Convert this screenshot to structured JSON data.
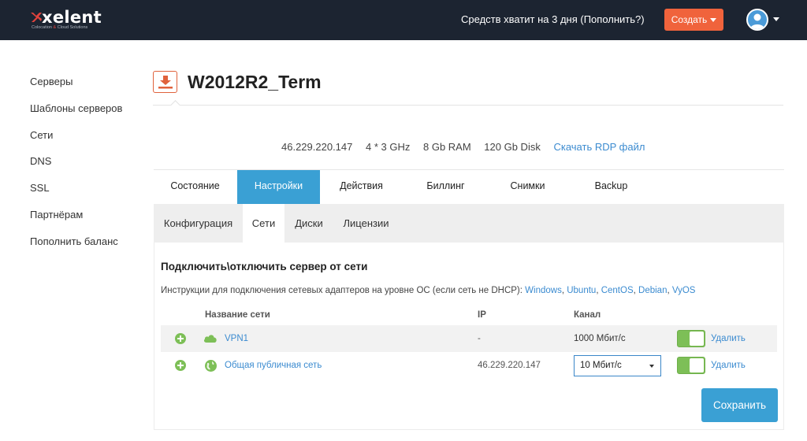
{
  "topbar": {
    "logo_text": "xelent",
    "logo_sub_left": "Colocation",
    "logo_sub_amp": "&",
    "logo_sub_right": "Cloud Solutions",
    "balance_text": "Средств хватит на 3 дня (Пополнить?)",
    "create_label": "Создать",
    "accent_color": "#f0633c",
    "bg_color": "#1c2431"
  },
  "sidebar": {
    "items": [
      {
        "label": "Серверы"
      },
      {
        "label": "Шаблоны серверов"
      },
      {
        "label": "Сети"
      },
      {
        "label": "DNS"
      },
      {
        "label": "SSL"
      },
      {
        "label": "Партнёрам"
      },
      {
        "label": "Пополнить баланс"
      }
    ]
  },
  "server": {
    "icon": "download-icon",
    "title": "W2012R2_Term",
    "ip": "46.229.220.147",
    "cpu": "4 * 3 GHz",
    "ram": "8 Gb RAM",
    "disk": "120 Gb Disk",
    "rdp_link": "Скачать RDP файл"
  },
  "main_tabs": [
    {
      "label": "Состояние",
      "active": false
    },
    {
      "label": "Настройки",
      "active": true
    },
    {
      "label": "Действия",
      "active": false
    },
    {
      "label": "Биллинг",
      "active": false
    },
    {
      "label": "Снимки",
      "active": false
    },
    {
      "label": "Backup",
      "active": false
    }
  ],
  "sub_tabs": [
    {
      "label": "Конфигурация",
      "active": false
    },
    {
      "label": "Сети",
      "active": true
    },
    {
      "label": "Диски",
      "active": false
    },
    {
      "label": "Лицензии",
      "active": false
    }
  ],
  "networks": {
    "section_title": "Подключить\\отключить сервер от сети",
    "instructions_prefix": "Инструкции для подключения сетевых адаптеров на уровне ОС (если сеть не DHCP):",
    "os_links": [
      "Windows",
      "Ubuntu",
      "CentOS",
      "Debian",
      "VyOS"
    ],
    "columns": {
      "name": "Название сети",
      "ip": "IP",
      "channel": "Канал"
    },
    "rows": [
      {
        "icon": "cloud-icon",
        "name": "VPN1",
        "ip": "-",
        "channel": "1000  Мбит/с",
        "channel_is_select": false,
        "enabled": true,
        "delete_label": "Удалить"
      },
      {
        "icon": "globe-icon",
        "name": "Общая публичная сеть",
        "ip": "46.229.220.147",
        "channel": "10 Мбит/с",
        "channel_is_select": true,
        "enabled": true,
        "delete_label": "Удалить"
      }
    ],
    "save_label": "Сохранить"
  }
}
